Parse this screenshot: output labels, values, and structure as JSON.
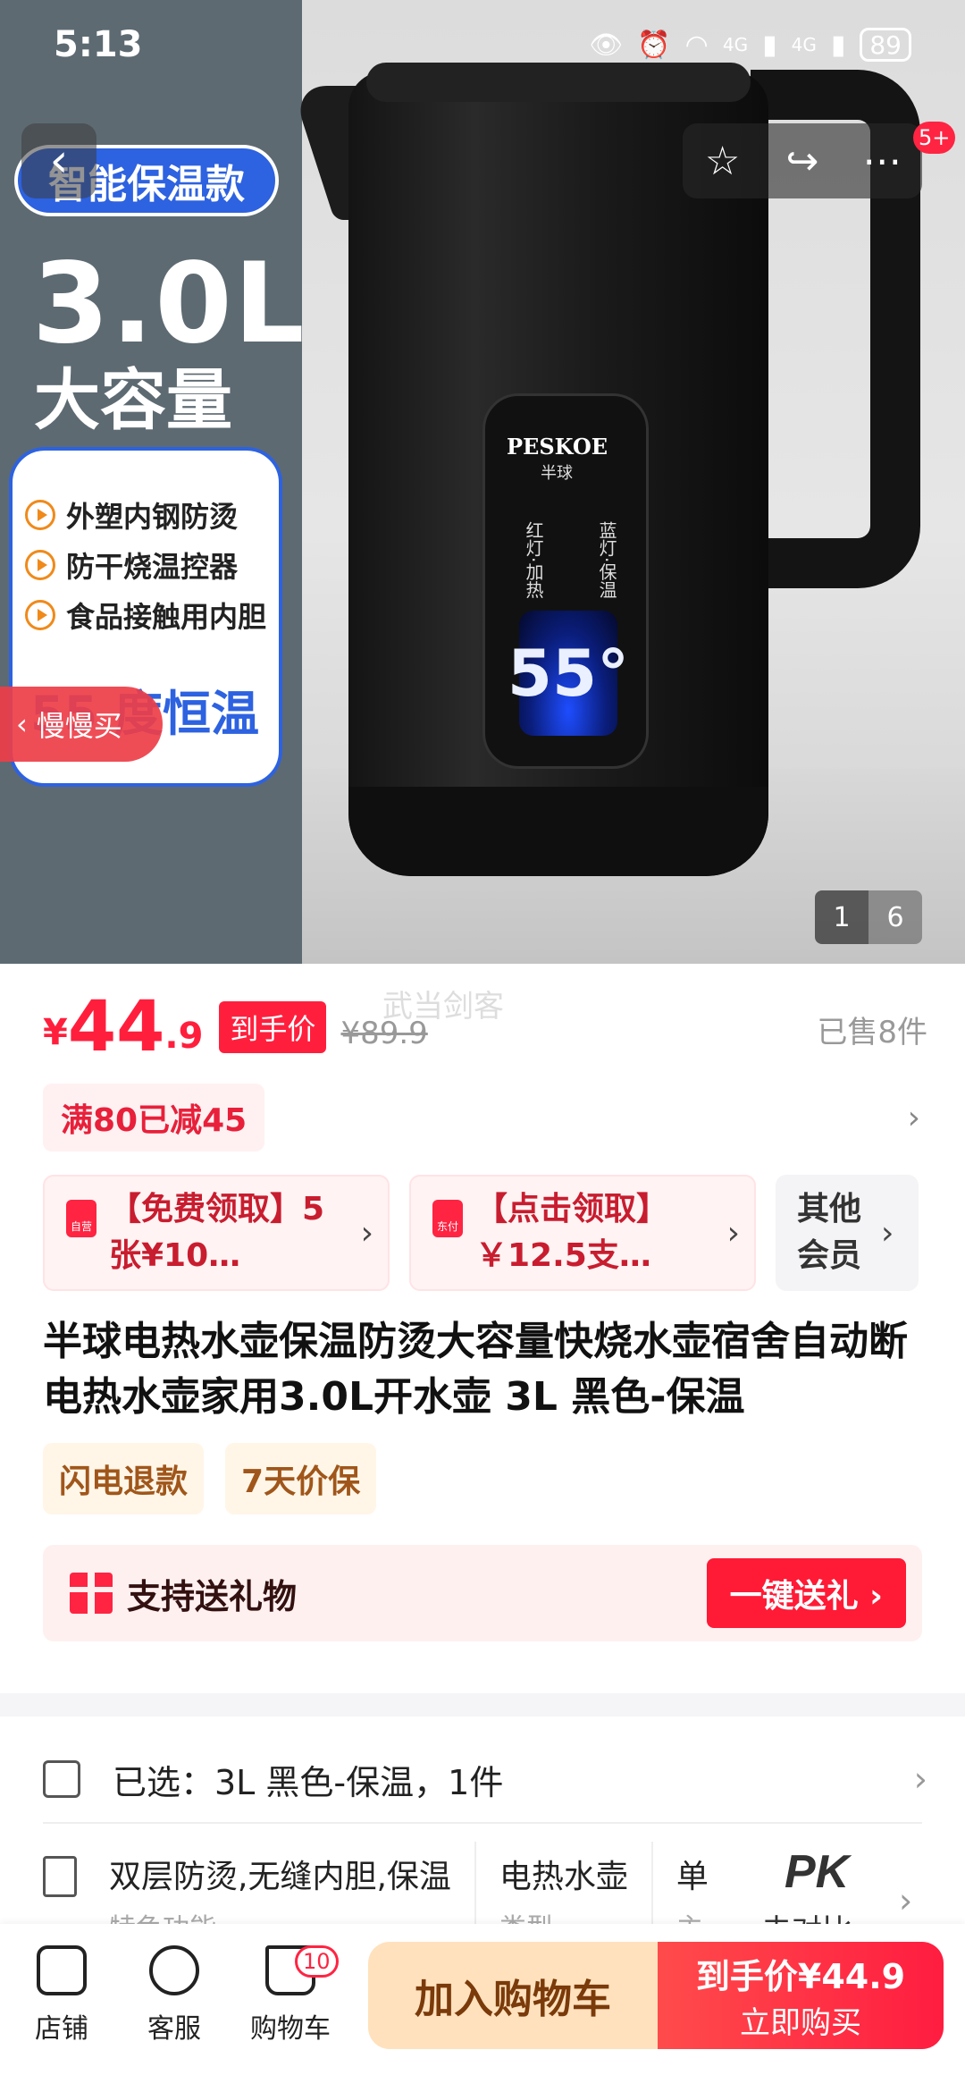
{
  "status_bar": {
    "time": "5:13",
    "network1": "4G",
    "network2": "4G",
    "battery": "89"
  },
  "hero": {
    "badge": "智能保温款",
    "capacity": "3.0L",
    "capacity_sub": "大容量",
    "features": [
      "外塑内钢防烫",
      "防干烧温控器",
      "食品接触用内胆"
    ],
    "constant_temp": "55 度恒温",
    "slow_buy": "慢慢买",
    "panel_brand": "PESKOE",
    "panel_brand_cn": "半球",
    "panel_left": "红灯·加热",
    "panel_right": "蓝灯·保温",
    "panel_display": "55°",
    "more_badge": "5+",
    "counter_current": "1",
    "counter_total": "6"
  },
  "price": {
    "currency": "¥",
    "integer": "44",
    "decimal": ".9",
    "tag": "到手价",
    "original": "¥89.9",
    "sold": "已售8件",
    "watermark": "武当剑客"
  },
  "discount": "满80已减45",
  "coupons": [
    {
      "icon_label": "自营",
      "text": "【免费领取】5张¥10…"
    },
    {
      "icon_label": "东付",
      "text": "【点击领取】￥12.5支…"
    }
  ],
  "member": "其他会员",
  "title": "半球电热水壶保温防烫大容量快烧水壶宿舍自动断电热水壶家用3.0L开水壶 3L 黑色-保温",
  "tags": [
    "闪电退款",
    "7天价保"
  ],
  "gift": {
    "label": "支持送礼物",
    "button": "一键送礼 ›"
  },
  "spec": {
    "selected": "已选：3L 黑色-保温，1件"
  },
  "features_row": {
    "col1_value": "双层防烫,无缝内胆,保温",
    "col1_key": "特色功能",
    "col2_value": "电热水壶",
    "col2_key": "类型",
    "col3_value": "单",
    "col3_key": "主",
    "pk": "PK",
    "pk_sub": "去对比"
  },
  "bottom": {
    "shop": "店铺",
    "service": "客服",
    "cart": "购物车",
    "cart_count": "10",
    "add_cart": "加入购物车",
    "buy_line1": "到手价¥44.9",
    "buy_line2": "立即购买"
  }
}
